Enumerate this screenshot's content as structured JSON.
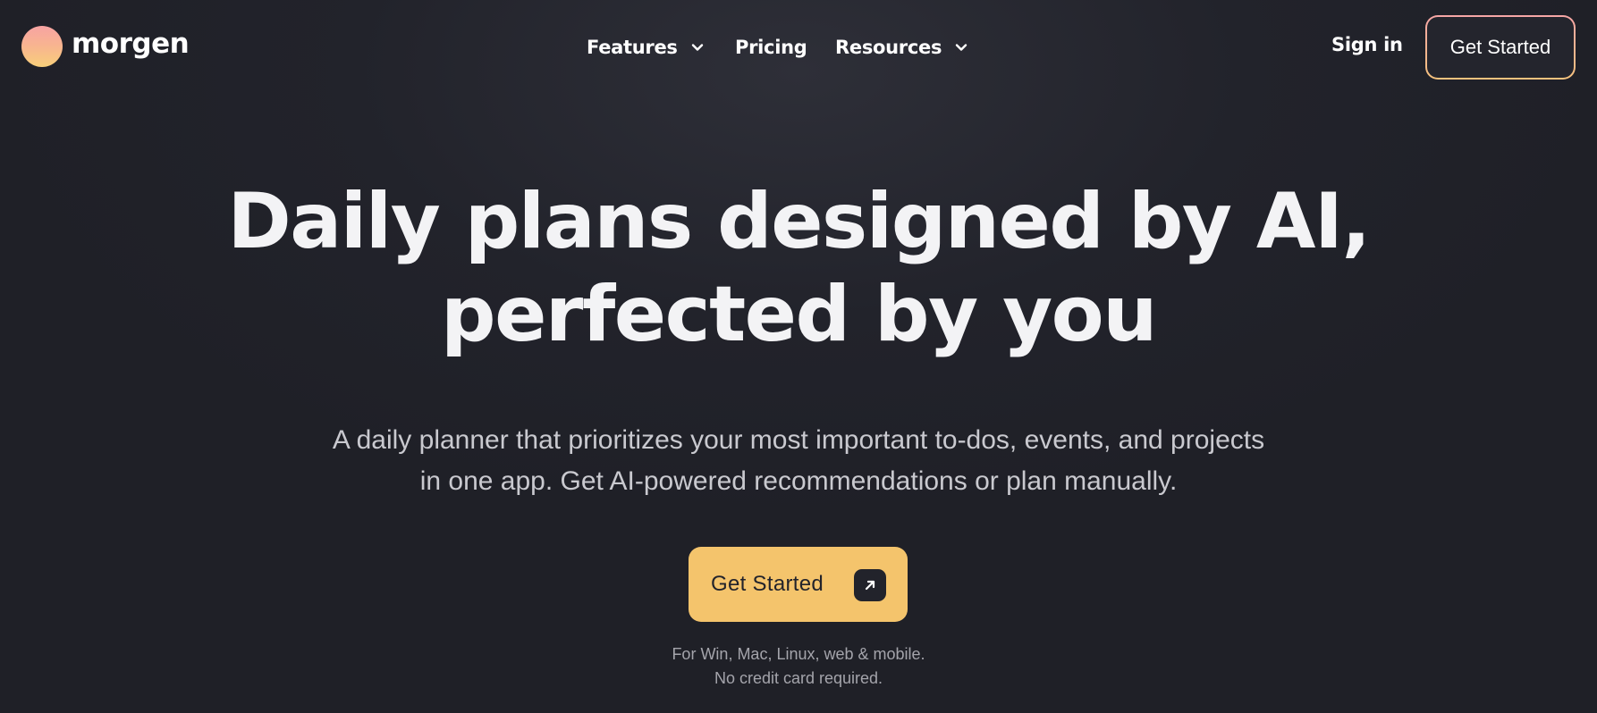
{
  "brand": {
    "name": "morgen",
    "logo_icon": "sunrise-circle-icon",
    "gradient": [
      "#f7a3a3",
      "#f8cf7a"
    ]
  },
  "nav": {
    "items": [
      {
        "label": "Features",
        "has_dropdown": true
      },
      {
        "label": "Pricing",
        "has_dropdown": false
      },
      {
        "label": "Resources",
        "has_dropdown": true
      }
    ]
  },
  "header": {
    "sign_in_label": "Sign in",
    "cta_label": "Get Started"
  },
  "hero": {
    "title_line1": "Daily plans designed by AI,",
    "title_line2": "perfected by you",
    "subtitle_line1": "A daily planner that prioritizes your most important to-dos, events, and projects",
    "subtitle_line2": "in one app. Get AI-powered recommendations or plan manually.",
    "cta_label": "Get Started",
    "cta_icon": "arrow-up-right-icon",
    "note_line1": "For Win, Mac, Linux, web & mobile.",
    "note_line2": "No credit card required."
  },
  "colors": {
    "background": "#22232b",
    "accent": "#f4c46c",
    "text": "#ffffff",
    "muted": "#a4a4ab"
  }
}
